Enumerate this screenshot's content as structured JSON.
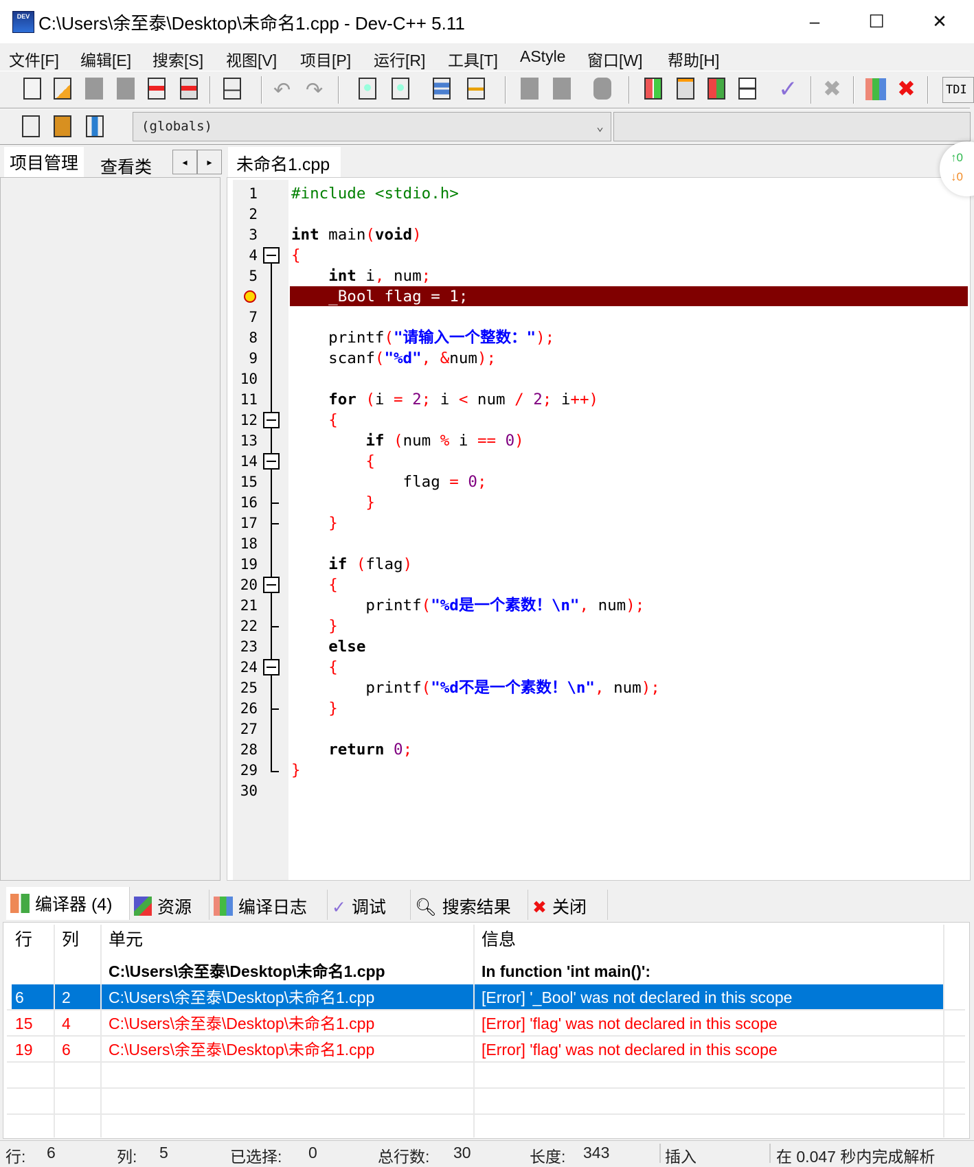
{
  "window": {
    "title": "C:\\Users\\余至泰\\Desktop\\未命名1.cpp - Dev-C++ 5.11",
    "icon_label": "DEV",
    "minimize": "–",
    "maximize": "☐",
    "close": "✕"
  },
  "menu": [
    "文件[F]",
    "编辑[E]",
    "搜索[S]",
    "视图[V]",
    "项目[P]",
    "运行[R]",
    "工具[T]",
    "AStyle",
    "窗口[W]",
    "帮助[H]"
  ],
  "toolbar": {
    "overflow_label": "TDI"
  },
  "globals_combo": {
    "value": "(globals)"
  },
  "left_panel": {
    "tabs": [
      "项目管理",
      "查看类"
    ],
    "nav_prev": "◂",
    "nav_next": "▸"
  },
  "editor": {
    "tab": "未命名1.cpp",
    "error_line": 6,
    "lines": [
      [
        [
          "pp",
          "#include <stdio.h>"
        ]
      ],
      [],
      [
        [
          "kw",
          "int"
        ],
        [
          "id",
          " main"
        ],
        [
          "sym",
          "("
        ],
        [
          "kw",
          "void"
        ],
        [
          "sym",
          ")"
        ]
      ],
      [
        [
          "sym",
          "{"
        ]
      ],
      [
        [
          "id",
          "    "
        ],
        [
          "kw",
          "int"
        ],
        [
          "id",
          " i"
        ],
        [
          "sym",
          ","
        ],
        [
          "id",
          " num"
        ],
        [
          "sym",
          ";"
        ]
      ],
      [
        [
          "id",
          "    _Bool flag = 1;"
        ]
      ],
      [],
      [
        [
          "id",
          "    printf"
        ],
        [
          "sym",
          "("
        ],
        [
          "str",
          "\"请输入一个整数：\""
        ],
        [
          "sym",
          ");"
        ]
      ],
      [
        [
          "id",
          "    scanf"
        ],
        [
          "sym",
          "("
        ],
        [
          "str",
          "\"%d\""
        ],
        [
          "sym",
          ", &"
        ],
        [
          "id",
          "num"
        ],
        [
          "sym",
          ");"
        ]
      ],
      [],
      [
        [
          "id",
          "    "
        ],
        [
          "kw",
          "for"
        ],
        [
          "id",
          " "
        ],
        [
          "sym",
          "("
        ],
        [
          "id",
          "i "
        ],
        [
          "sym",
          "="
        ],
        [
          "id",
          " "
        ],
        [
          "num",
          "2"
        ],
        [
          "sym",
          ";"
        ],
        [
          "id",
          " i "
        ],
        [
          "sym",
          "<"
        ],
        [
          "id",
          " num "
        ],
        [
          "sym",
          "/"
        ],
        [
          "id",
          " "
        ],
        [
          "num",
          "2"
        ],
        [
          "sym",
          ";"
        ],
        [
          "id",
          " i"
        ],
        [
          "sym",
          "++)"
        ]
      ],
      [
        [
          "id",
          "    "
        ],
        [
          "sym",
          "{"
        ]
      ],
      [
        [
          "id",
          "        "
        ],
        [
          "kw",
          "if"
        ],
        [
          "id",
          " "
        ],
        [
          "sym",
          "("
        ],
        [
          "id",
          "num "
        ],
        [
          "sym",
          "%"
        ],
        [
          "id",
          " i "
        ],
        [
          "sym",
          "=="
        ],
        [
          "id",
          " "
        ],
        [
          "num",
          "0"
        ],
        [
          "sym",
          ")"
        ]
      ],
      [
        [
          "id",
          "        "
        ],
        [
          "sym",
          "{"
        ]
      ],
      [
        [
          "id",
          "            flag "
        ],
        [
          "sym",
          "="
        ],
        [
          "id",
          " "
        ],
        [
          "num",
          "0"
        ],
        [
          "sym",
          ";"
        ]
      ],
      [
        [
          "id",
          "        "
        ],
        [
          "sym",
          "}"
        ]
      ],
      [
        [
          "id",
          "    "
        ],
        [
          "sym",
          "}"
        ]
      ],
      [],
      [
        [
          "id",
          "    "
        ],
        [
          "kw",
          "if"
        ],
        [
          "id",
          " "
        ],
        [
          "sym",
          "("
        ],
        [
          "id",
          "flag"
        ],
        [
          "sym",
          ")"
        ]
      ],
      [
        [
          "id",
          "    "
        ],
        [
          "sym",
          "{"
        ]
      ],
      [
        [
          "id",
          "        printf"
        ],
        [
          "sym",
          "("
        ],
        [
          "str",
          "\"%d是一个素数！\\n\""
        ],
        [
          "sym",
          ","
        ],
        [
          "id",
          " num"
        ],
        [
          "sym",
          ");"
        ]
      ],
      [
        [
          "id",
          "    "
        ],
        [
          "sym",
          "}"
        ]
      ],
      [
        [
          "id",
          "    "
        ],
        [
          "kw",
          "else"
        ]
      ],
      [
        [
          "id",
          "    "
        ],
        [
          "sym",
          "{"
        ]
      ],
      [
        [
          "id",
          "        printf"
        ],
        [
          "sym",
          "("
        ],
        [
          "str",
          "\"%d不是一个素数！\\n\""
        ],
        [
          "sym",
          ","
        ],
        [
          "id",
          " num"
        ],
        [
          "sym",
          ");"
        ]
      ],
      [
        [
          "id",
          "    "
        ],
        [
          "sym",
          "}"
        ]
      ],
      [],
      [
        [
          "id",
          "    "
        ],
        [
          "kw",
          "return"
        ],
        [
          "id",
          " "
        ],
        [
          "num",
          "0"
        ],
        [
          "sym",
          ";"
        ]
      ],
      [
        [
          "sym",
          "}"
        ]
      ],
      []
    ],
    "fold_lines": [
      4,
      12,
      14,
      20,
      24
    ]
  },
  "float_widget": {
    "up": "↑0",
    "down": "↓0",
    "up_color": "#2db84d",
    "down_color": "#f28c28"
  },
  "bottom_tabs": [
    "编译器 (4)",
    "资源",
    "编译日志",
    "调试",
    "搜索结果",
    "关闭"
  ],
  "messages": {
    "headers": [
      "行",
      "列",
      "单元",
      "信息"
    ],
    "rows": [
      {
        "line": "",
        "col": "",
        "unit": "C:\\Users\\余至泰\\Desktop\\未命名1.cpp",
        "msg": "In function 'int main()':",
        "style": "bold"
      },
      {
        "line": "6",
        "col": "2",
        "unit": "C:\\Users\\余至泰\\Desktop\\未命名1.cpp",
        "msg": "[Error] '_Bool' was not declared in this scope",
        "style": "selected"
      },
      {
        "line": "15",
        "col": "4",
        "unit": "C:\\Users\\余至泰\\Desktop\\未命名1.cpp",
        "msg": "[Error] 'flag' was not declared in this scope",
        "style": "error"
      },
      {
        "line": "19",
        "col": "6",
        "unit": "C:\\Users\\余至泰\\Desktop\\未命名1.cpp",
        "msg": "[Error] 'flag' was not declared in this scope",
        "style": "error"
      }
    ]
  },
  "status": {
    "row_label": "行:",
    "row": "6",
    "col_label": "列:",
    "col": "5",
    "sel_label": "已选择:",
    "sel": "0",
    "total_label": "总行数:",
    "total": "30",
    "len_label": "长度:",
    "len": "343",
    "mode": "插入",
    "parse": "在 0.047 秒内完成解析"
  },
  "colors": {
    "error_line_bg": "#800000",
    "selection": "#0078d7",
    "error_text": "#ff0000"
  }
}
